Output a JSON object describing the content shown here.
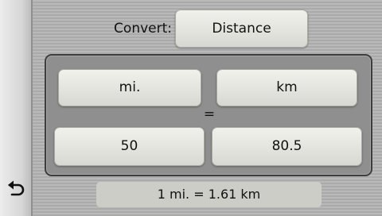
{
  "convert": {
    "label": "Convert:",
    "category": "Distance"
  },
  "units": {
    "from": "mi.",
    "to": "km",
    "equals_sign": "="
  },
  "values": {
    "from": "50",
    "to": "80.5"
  },
  "rate": "1 mi. = 1.61 km",
  "icons": {
    "back": "back-arrow-icon"
  },
  "colors": {
    "button_face": "#e4e4de",
    "panel": "#8f8f8f",
    "panel_border": "#3e3e3e",
    "rate_bar": "#cdcdc8"
  }
}
